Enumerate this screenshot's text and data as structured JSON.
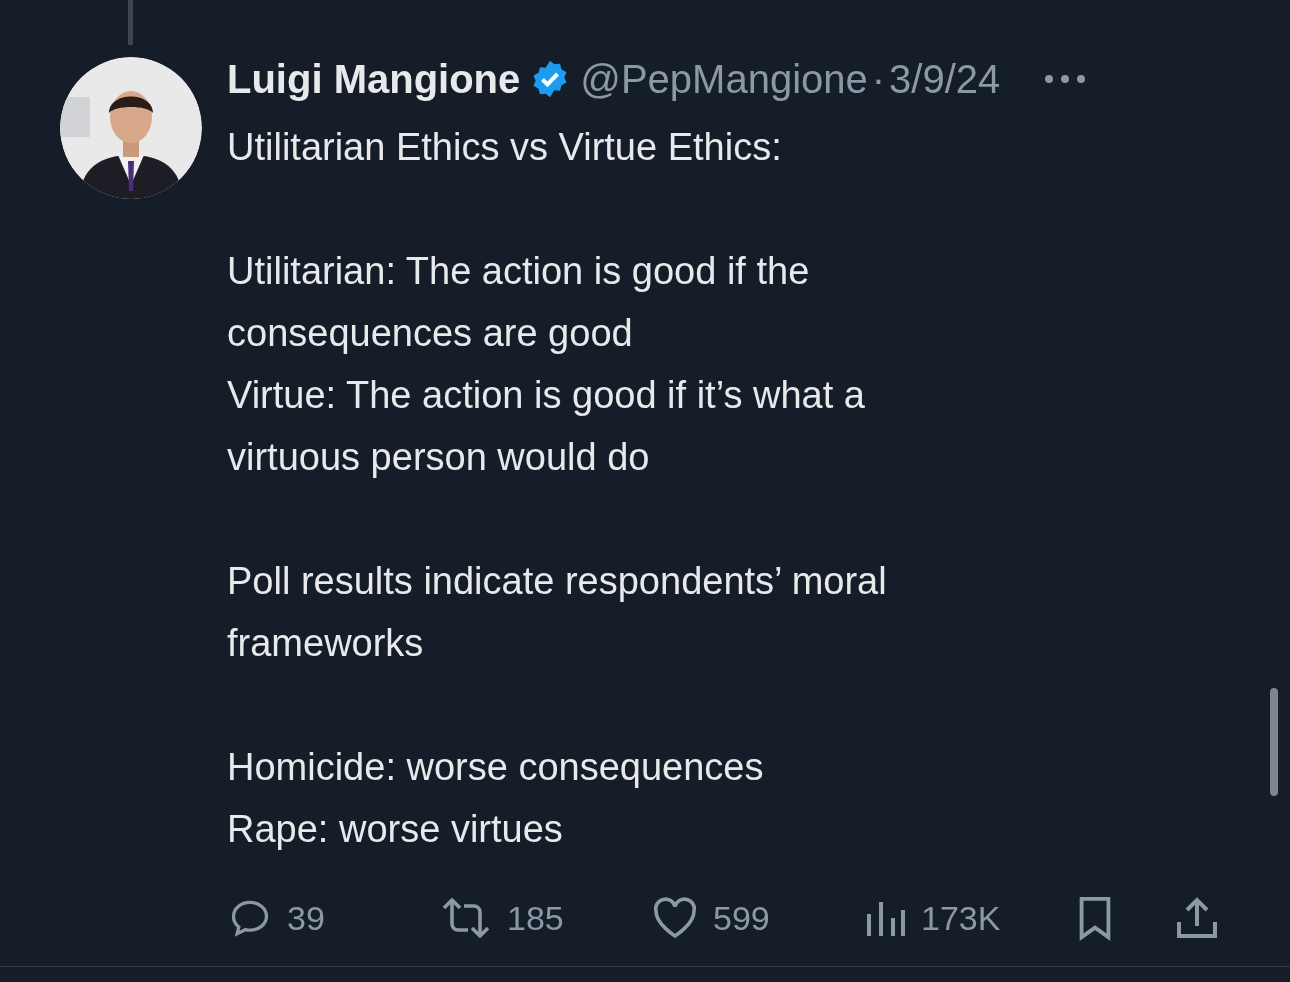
{
  "tweet": {
    "author": {
      "name": "Luigi Mangione",
      "verified": true,
      "handle": "@PepMangione",
      "separator": "·",
      "date": "3/9/24"
    },
    "avatar": {
      "kind": "picture"
    },
    "body": [
      [
        "Utilitarian Ethics vs Virtue Ethics:"
      ],
      [
        "Utilitarian: The action is good if the",
        "consequences are good",
        "Virtue: The action is good if it’s what a",
        "virtuous person would do"
      ],
      [
        "Poll results indicate respondents’ moral",
        "frameworks"
      ],
      [
        "Homicide: worse consequences",
        "Rape: worse virtues"
      ]
    ],
    "actions": [
      {
        "kind": "reply",
        "count": "39"
      },
      {
        "kind": "retweet",
        "count": "185"
      },
      {
        "kind": "like",
        "count": "599"
      },
      {
        "kind": "views",
        "count": "173K"
      },
      {
        "kind": "bookmark"
      },
      {
        "kind": "share"
      }
    ]
  }
}
